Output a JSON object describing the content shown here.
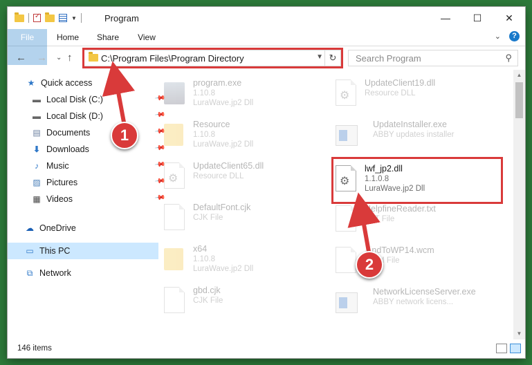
{
  "window": {
    "title": "Program",
    "controls": {
      "minimize": "—",
      "maximize": "☐",
      "close": "✕"
    }
  },
  "ribbon": {
    "tabs": [
      "File",
      "Home",
      "Share",
      "View"
    ],
    "expand_glyph": "⌄",
    "help_glyph": "?"
  },
  "nav": {
    "back": "←",
    "forward": "→",
    "recent": "⌄",
    "up": "↑",
    "address": "C:\\Program Files\\Program Directory",
    "refresh": "↻",
    "search_placeholder": "Search Program"
  },
  "sidebar": {
    "items": [
      {
        "label": "Quick access",
        "icon": "star-icon",
        "pinned": false
      },
      {
        "label": "Local Disk (C:)",
        "icon": "drive-icon",
        "pinned": true
      },
      {
        "label": "Local Disk (D:)",
        "icon": "drive-icon",
        "pinned": true
      },
      {
        "label": "Documents",
        "icon": "documents-icon",
        "pinned": true
      },
      {
        "label": "Downloads",
        "icon": "download-icon",
        "pinned": true
      },
      {
        "label": "Music",
        "icon": "music-icon",
        "pinned": true
      },
      {
        "label": "Pictures",
        "icon": "pictures-icon",
        "pinned": true
      },
      {
        "label": "Videos",
        "icon": "videos-icon",
        "pinned": true
      },
      {
        "label": "OneDrive",
        "icon": "cloud-icon",
        "pinned": false
      },
      {
        "label": "This PC",
        "icon": "computer-icon",
        "pinned": false,
        "selected": true
      },
      {
        "label": "Network",
        "icon": "network-icon",
        "pinned": false
      }
    ]
  },
  "files": [
    {
      "name": "program.exe",
      "line1": "1.10.8",
      "line2": "LuraWave.jp2 Dll",
      "icon": "setup"
    },
    {
      "name": "UpdateClient19.dll",
      "line1": "Resource DLL",
      "line2": "",
      "icon": "dll"
    },
    {
      "name": "Resource",
      "line1": "1.10.8",
      "line2": "LuraWave.jp2 Dll",
      "icon": "folder"
    },
    {
      "name": "UpdateInstaller.exe",
      "line1": "ABBY updates installer",
      "line2": "",
      "icon": "app"
    },
    {
      "name": "UpdateClient65.dll",
      "line1": "Resource DLL",
      "line2": "",
      "icon": "dll"
    },
    {
      "name": "lwf_jp2.dll",
      "line1": "1.1.0.8",
      "line2": "LuraWave.jp2 Dll",
      "icon": "dll",
      "focus": true
    },
    {
      "name": "DefaultFont.cjk",
      "line1": "CJK File",
      "line2": "",
      "icon": "doc"
    },
    {
      "name": "HelpfineReader.txt",
      "line1": "TXT File",
      "line2": "",
      "icon": "doc"
    },
    {
      "name": "x64",
      "line1": "1.10.8",
      "line2": "LuraWave.jp2 Dll",
      "icon": "folder"
    },
    {
      "name": "FindToWP14.wcm",
      "line1": "WCM File",
      "line2": "",
      "icon": "doc"
    },
    {
      "name": "gbd.cjk",
      "line1": "CJK File",
      "line2": "",
      "icon": "doc"
    },
    {
      "name": "NetworkLicenseServer.exe",
      "line1": "ABBY network licens...",
      "line2": "",
      "icon": "app"
    }
  ],
  "status": {
    "count": "146 items"
  },
  "callouts": [
    "1",
    "2"
  ],
  "colors": {
    "accent": "#1979ca",
    "highlight": "#d93a3a",
    "selected": "#cce8ff"
  }
}
